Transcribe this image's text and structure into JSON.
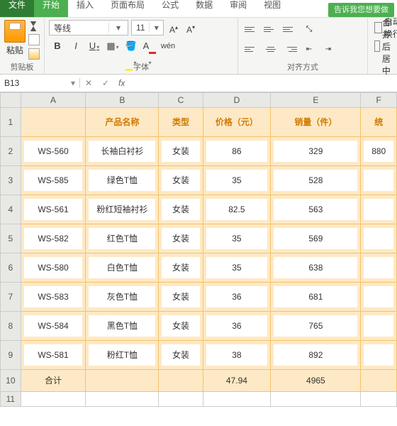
{
  "tabs": {
    "file": "文件",
    "home": "开始",
    "insert": "插入",
    "layout": "页面布局",
    "formula": "公式",
    "data": "数据",
    "review": "审阅",
    "view": "视图"
  },
  "hint": "告诉我您想要做",
  "ribbon": {
    "clipboard": {
      "paste": "粘贴",
      "label": "剪贴板"
    },
    "font": {
      "name": "等线",
      "size": "11",
      "label": "字体",
      "wen": "wén"
    },
    "align": {
      "label": "对齐方式",
      "wrap": "自动换行",
      "merge": "合并后居中"
    }
  },
  "namebox": "B13",
  "fx": "fx",
  "cols": [
    "A",
    "B",
    "C",
    "D",
    "E",
    "F"
  ],
  "headers": {
    "B": "产品名称",
    "C": "类型",
    "D": "价格（元）",
    "E": "销量（件）",
    "F": "统"
  },
  "rows": [
    {
      "A": "WS-560",
      "B": "长袖白衬衫",
      "C": "女装",
      "D": "86",
      "E": "329",
      "F": "880"
    },
    {
      "A": "WS-585",
      "B": "绿色T恤",
      "C": "女装",
      "D": "35",
      "E": "528",
      "F": ""
    },
    {
      "A": "WS-561",
      "B": "粉红短袖衬衫",
      "C": "女装",
      "D": "82.5",
      "E": "563",
      "F": ""
    },
    {
      "A": "WS-582",
      "B": "红色T恤",
      "C": "女装",
      "D": "35",
      "E": "569",
      "F": ""
    },
    {
      "A": "WS-580",
      "B": "白色T恤",
      "C": "女装",
      "D": "35",
      "E": "638",
      "F": ""
    },
    {
      "A": "WS-583",
      "B": "灰色T恤",
      "C": "女装",
      "D": "36",
      "E": "681",
      "F": ""
    },
    {
      "A": "WS-584",
      "B": "黑色T恤",
      "C": "女装",
      "D": "36",
      "E": "765",
      "F": ""
    },
    {
      "A": "WS-581",
      "B": "粉红T恤",
      "C": "女装",
      "D": "38",
      "E": "892",
      "F": ""
    },
    {
      "A": "合计",
      "B": "",
      "C": "",
      "D": "47.94",
      "E": "4965",
      "F": ""
    }
  ],
  "white_cells": [
    [
      0,
      "B"
    ],
    [
      0,
      "D"
    ],
    [
      2,
      "B"
    ],
    [
      2,
      "D"
    ]
  ],
  "colors": {
    "accent": "#4caf50",
    "theme_border": "#f5c36a",
    "theme_fill": "#fde9c5",
    "header_text": "#d17a00"
  }
}
